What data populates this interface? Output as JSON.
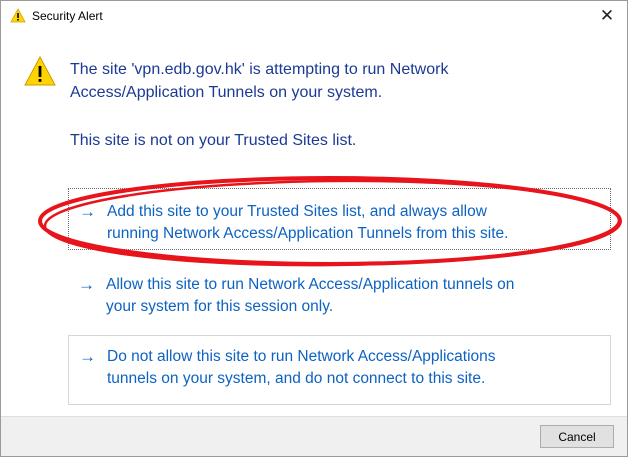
{
  "window": {
    "title": "Security Alert",
    "close_glyph": "✕"
  },
  "alert": {
    "icon": "warning-icon",
    "message_line1": "The site 'vpn.edb.gov.hk' is attempting to run Network",
    "message_line2": "Access/Application Tunnels on your system.",
    "subtext": "This site is not on your Trusted Sites list."
  },
  "options": [
    {
      "arrow": "→",
      "line1": "Add this site to your Trusted Sites list, and always allow",
      "line2": "running Network Access/Application Tunnels from this site."
    },
    {
      "arrow": "→",
      "line1": "Allow this site to run Network Access/Application tunnels on",
      "line2": "your system for this session only."
    },
    {
      "arrow": "→",
      "line1": "Do not allow this site to run Network Access/Applications",
      "line2": "tunnels on your system, and do not connect to this site."
    }
  ],
  "footer": {
    "cancel_label": "Cancel"
  },
  "colors": {
    "message_text": "#1b3a93",
    "link_text": "#0d62c2",
    "annotation_ellipse": "#e8141c",
    "warning_fill": "#ffd400"
  }
}
